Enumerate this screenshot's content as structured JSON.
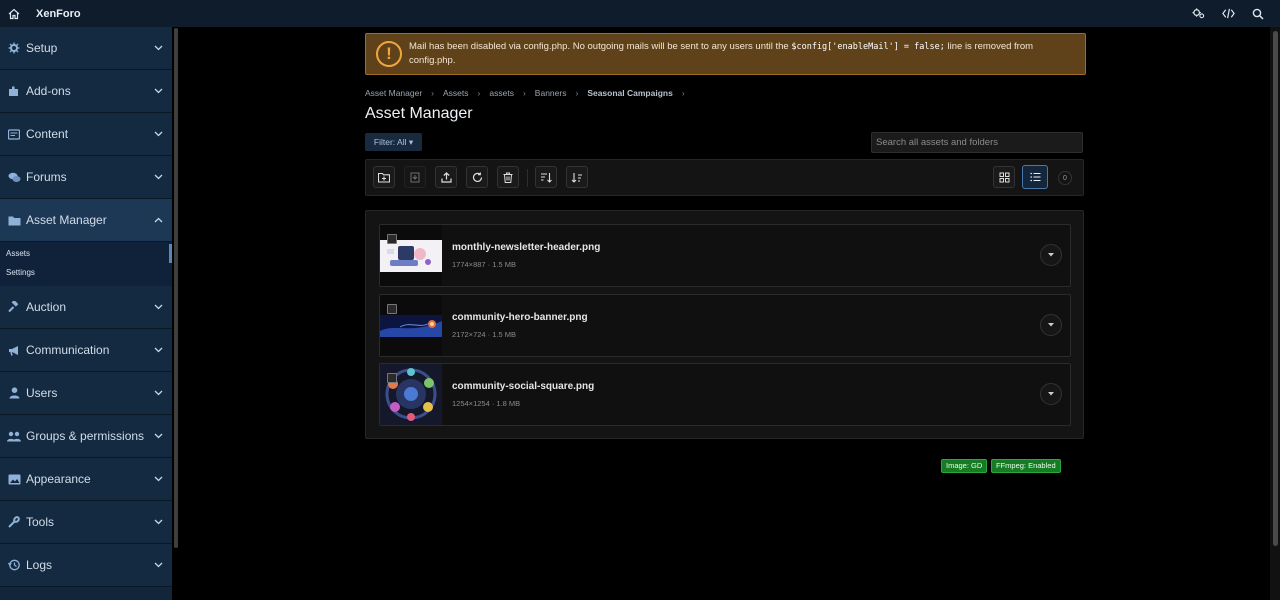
{
  "topbar": {
    "brand": "XenForo",
    "icons": [
      "home-icon",
      "cogs-icon",
      "code-icon",
      "search-icon"
    ]
  },
  "sidebar": {
    "sections": [
      {
        "label": "Setup",
        "icon": "gear-icon"
      },
      {
        "label": "Add-ons",
        "icon": "puzzle-icon"
      },
      {
        "label": "Content",
        "icon": "content-icon"
      },
      {
        "label": "Forums",
        "icon": "forums-icon"
      },
      {
        "label": "Asset Manager",
        "icon": "folder-icon"
      },
      {
        "label": "Auction",
        "icon": "gavel-icon"
      },
      {
        "label": "Communication",
        "icon": "megaphone-icon"
      },
      {
        "label": "Users",
        "icon": "user-icon"
      },
      {
        "label": "Groups & permissions",
        "icon": "users-icon"
      },
      {
        "label": "Appearance",
        "icon": "image-icon"
      },
      {
        "label": "Tools",
        "icon": "wrench-icon"
      },
      {
        "label": "Logs",
        "icon": "history-icon"
      }
    ],
    "asset_sub": [
      "Assets",
      "Settings"
    ]
  },
  "notice": {
    "text_before": "Mail has been disabled via config.php. No outgoing mails will be sent to any users until the ",
    "code": "$config['enableMail'] = false;",
    "text_after": " line is removed from config.php."
  },
  "breadcrumbs": [
    "Asset Manager",
    "Assets",
    "assets",
    "Banners",
    "Seasonal Campaigns"
  ],
  "page_title": "Asset Manager",
  "filter_label": "Filter: All ▾",
  "search_placeholder": "Search all assets and folders",
  "item_count": "0",
  "assets": [
    {
      "name": "monthly-newsletter-header.png",
      "meta": "1774×887 · 1.5 MB"
    },
    {
      "name": "community-hero-banner.png",
      "meta": "2172×724 · 1.5 MB"
    },
    {
      "name": "community-social-square.png",
      "meta": "1254×1254 · 1.8 MB"
    }
  ],
  "badges": {
    "image": "Image: GD",
    "ffmpeg": "FFmpeg: Enabled"
  },
  "colors": {
    "sidebar_bg": "#13253a",
    "topbar_bg": "#0f1c2b",
    "notice_bg": "#60421a",
    "badge_green": "#177a24",
    "accent": "#4a78ad"
  }
}
